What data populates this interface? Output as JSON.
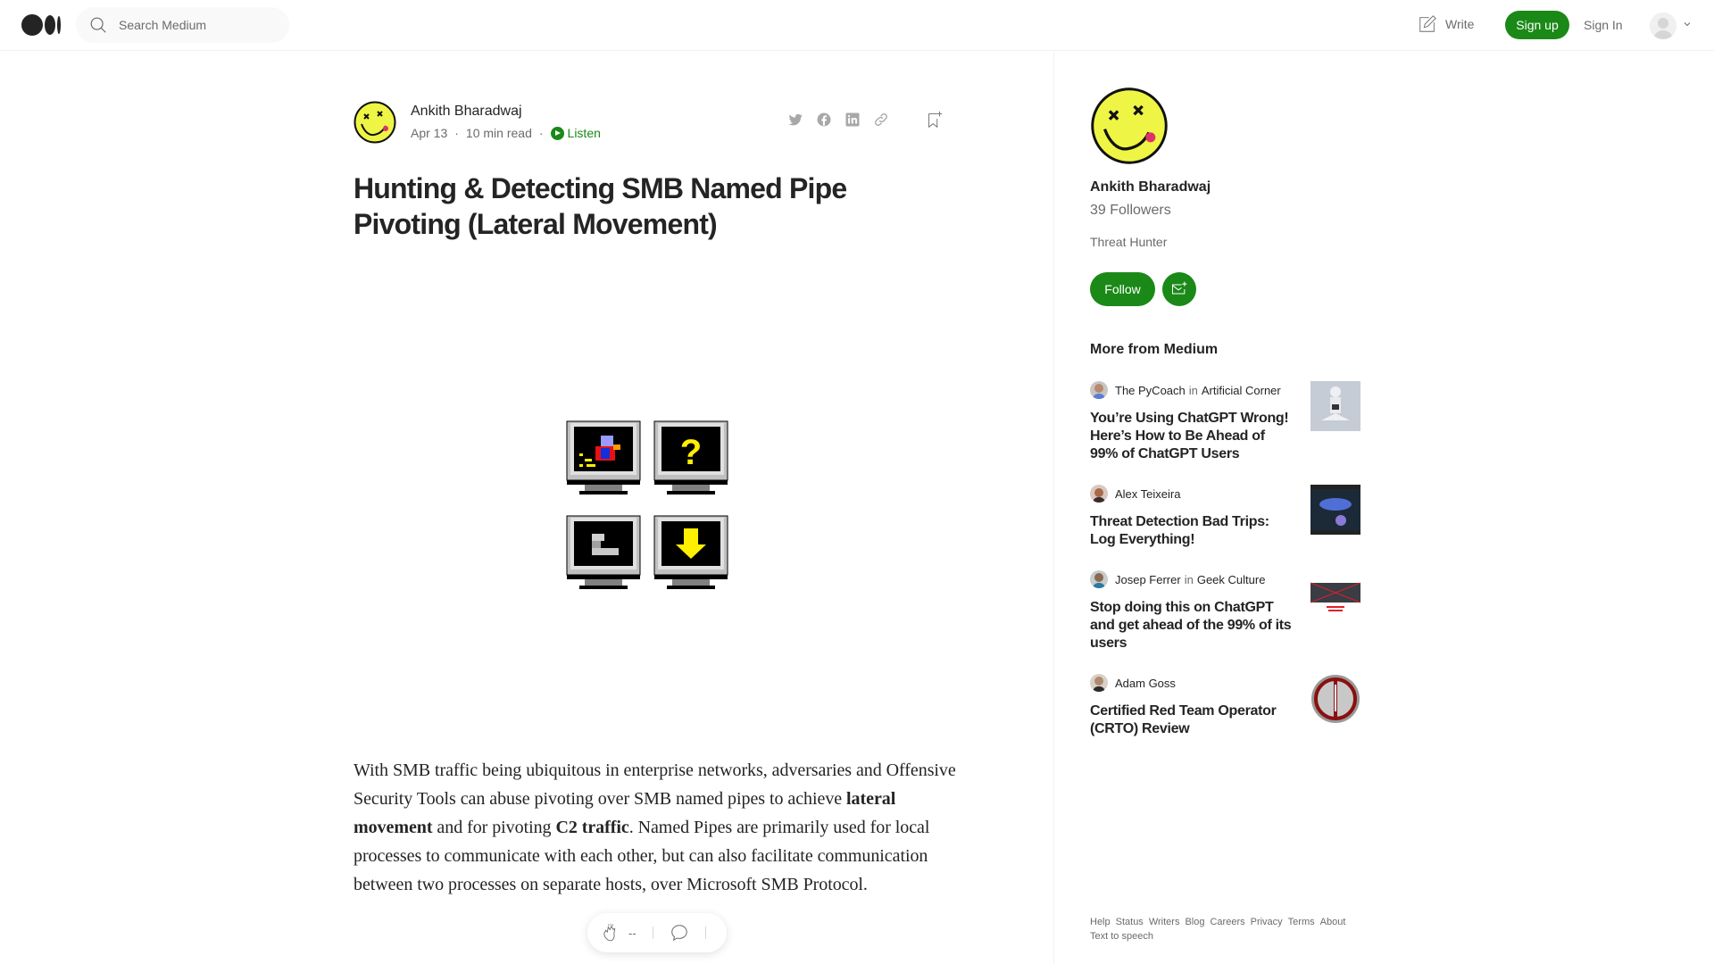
{
  "nav": {
    "logo": "medium-logo",
    "search_placeholder": "Search Medium",
    "write_label": "Write",
    "signup_label": "Sign up",
    "signin_label": "Sign In"
  },
  "article": {
    "author": "Ankith Bharadwaj",
    "date": "Apr 13",
    "read_time": "10 min read",
    "listen_label": "Listen",
    "share_icons": [
      "twitter-icon",
      "facebook-icon",
      "linkedin-icon",
      "link-icon"
    ],
    "title": "Hunting & Detecting SMB Named Pipe Pivoting (Lateral Movement)",
    "body": {
      "p1_a": "With SMB traffic being ubiquitous in enterprise networks, adversaries and Offensive Security Tools can abuse pivoting over SMB named pipes to achieve ",
      "p1_b": "lateral movement",
      "p1_c": " and for pivoting ",
      "p1_d": "C2 traffic",
      "p1_e": ". Named Pipes are primarily used for local processes to communicate with each other, but can also facilitate communication between two processes on separate hosts, over Microsoft SMB Protocol."
    },
    "clap_count": "--"
  },
  "sidebar": {
    "author": "Ankith Bharadwaj",
    "followers": "39 Followers",
    "bio": "Threat Hunter",
    "follow_label": "Follow",
    "more_title": "More from Medium",
    "recs": [
      {
        "author": "The PyCoach",
        "in": "in",
        "publication": "Artificial Corner",
        "title": "You’re Using ChatGPT Wrong! Here’s How to Be Ahead of 99% of ChatGPT Users"
      },
      {
        "author": "Alex Teixeira",
        "in": "",
        "publication": "",
        "title": "Threat Detection Bad Trips: Log Everything!"
      },
      {
        "author": "Josep Ferrer",
        "in": "in",
        "publication": "Geek Culture",
        "title": "Stop doing this on ChatGPT and get ahead of the 99% of its users"
      },
      {
        "author": "Adam Goss",
        "in": "",
        "publication": "",
        "title": "Certified Red Team Operator (CRTO) Review"
      }
    ],
    "footer": [
      "Help",
      "Status",
      "Writers",
      "Blog",
      "Careers",
      "Privacy",
      "Terms",
      "About",
      "Text to speech"
    ]
  },
  "colors": {
    "accent": "#1a8917",
    "text": "#242424",
    "muted": "#6b6b6b"
  }
}
